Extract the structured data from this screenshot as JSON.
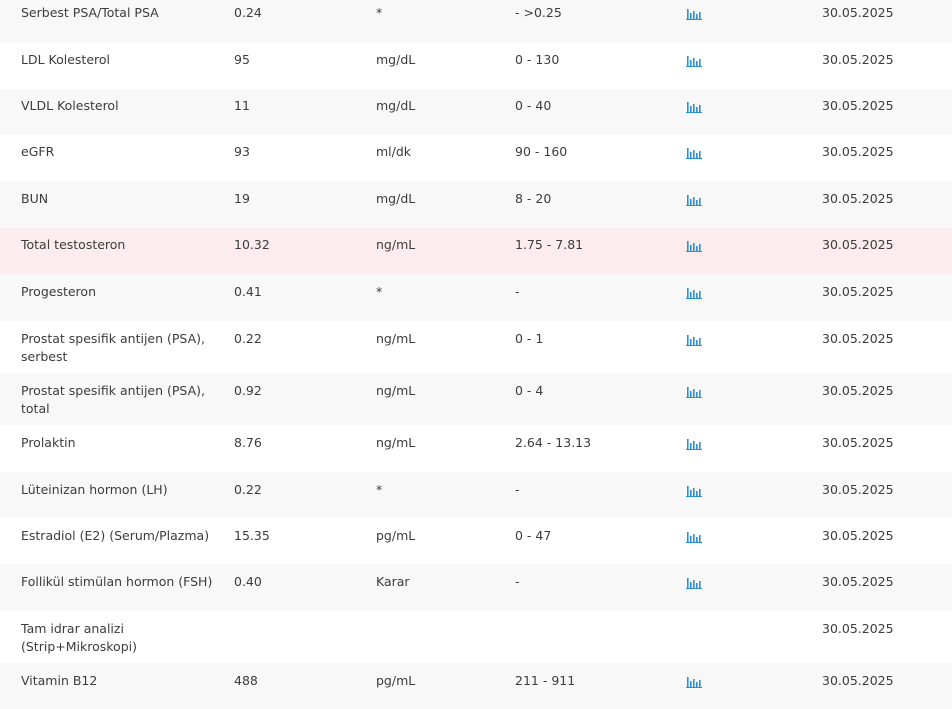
{
  "colors": {
    "abnormal_row_bg": "#fdecee",
    "alt_row_bg": "#f8f8f8",
    "graph_icon": "#2a8fd4",
    "text": "#3c3c3c"
  },
  "rows": [
    {
      "name": "Serbest PSA/Total PSA",
      "value": "0.24",
      "unit": "*",
      "ref": "- >0.25",
      "has_graph": true,
      "date": "30.05.2025",
      "abnormal": false
    },
    {
      "name": "LDL Kolesterol",
      "value": "95",
      "unit": "mg/dL",
      "ref": "0 - 130",
      "has_graph": true,
      "date": "30.05.2025",
      "abnormal": false
    },
    {
      "name": "VLDL Kolesterol",
      "value": "11",
      "unit": "mg/dL",
      "ref": "0 - 40",
      "has_graph": true,
      "date": "30.05.2025",
      "abnormal": false
    },
    {
      "name": "eGFR",
      "value": "93",
      "unit": "ml/dk",
      "ref": "90 - 160",
      "has_graph": true,
      "date": "30.05.2025",
      "abnormal": false
    },
    {
      "name": "BUN",
      "value": "19",
      "unit": "mg/dL",
      "ref": "8 - 20",
      "has_graph": true,
      "date": "30.05.2025",
      "abnormal": false
    },
    {
      "name": "Total testosteron",
      "value": "10.32",
      "unit": "ng/mL",
      "ref": "1.75 - 7.81",
      "has_graph": true,
      "date": "30.05.2025",
      "abnormal": true
    },
    {
      "name": "Progesteron",
      "value": "0.41",
      "unit": "*",
      "ref": "-",
      "has_graph": true,
      "date": "30.05.2025",
      "abnormal": false
    },
    {
      "name": "Prostat spesifik antijen (PSA),",
      "name_line2": "serbest",
      "value": "0.22",
      "unit": "ng/mL",
      "ref": "0 - 1",
      "has_graph": true,
      "date": "30.05.2025",
      "abnormal": false
    },
    {
      "name": "Prostat spesifik antijen (PSA),",
      "name_line2": "total",
      "value": "0.92",
      "unit": "ng/mL",
      "ref": "0 - 4",
      "has_graph": true,
      "date": "30.05.2025",
      "abnormal": false
    },
    {
      "name": "Prolaktin",
      "value": "8.76",
      "unit": "ng/mL",
      "ref": "2.64 - 13.13",
      "has_graph": true,
      "date": "30.05.2025",
      "abnormal": false
    },
    {
      "name": "Lüteinizan hormon (LH)",
      "value": "0.22",
      "unit": "*",
      "ref": "-",
      "has_graph": true,
      "date": "30.05.2025",
      "abnormal": false
    },
    {
      "name": "Estradiol (E2) (Serum/Plazma)",
      "value": "15.35",
      "unit": "pg/mL",
      "ref": "0 - 47",
      "has_graph": true,
      "date": "30.05.2025",
      "abnormal": false
    },
    {
      "name": "Follikül stimülan hormon (FSH)",
      "value": "0.40",
      "unit": "Karar",
      "ref": "-",
      "has_graph": true,
      "date": "30.05.2025",
      "abnormal": false
    },
    {
      "name": "Tam idrar analizi",
      "name_line2": "(Strip+Mikroskopi)",
      "value": "",
      "unit": "",
      "ref": "",
      "has_graph": false,
      "date": "30.05.2025",
      "abnormal": false
    },
    {
      "name": "Vitamin B12",
      "value": "488",
      "unit": "pg/mL",
      "ref": "211 - 911",
      "has_graph": true,
      "date": "30.05.2025",
      "abnormal": false
    }
  ]
}
